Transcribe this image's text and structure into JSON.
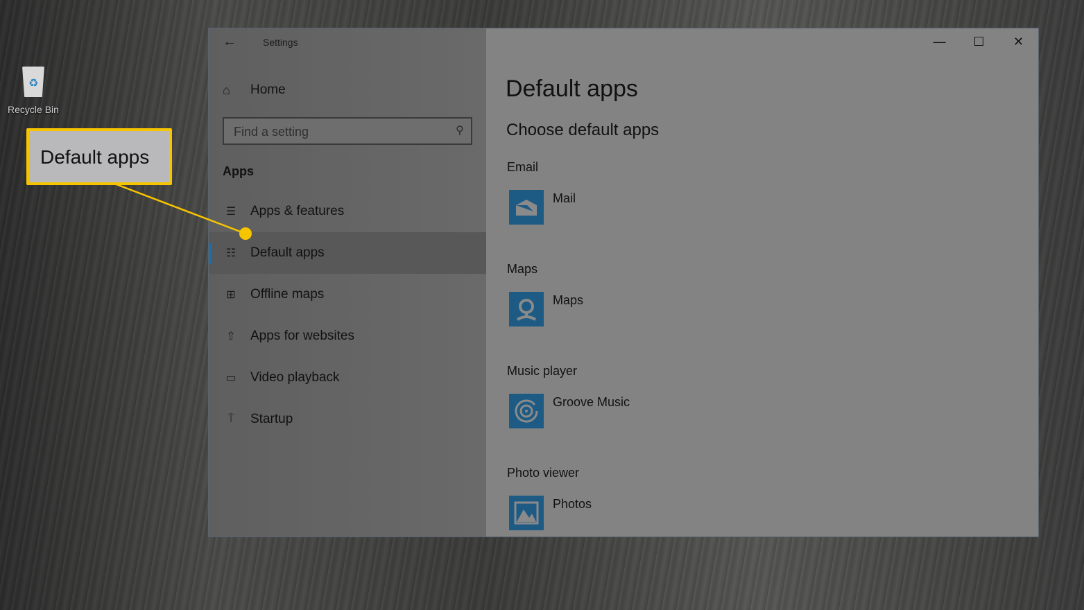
{
  "desktop": {
    "recycle_bin_label": "Recycle Bin"
  },
  "callout": {
    "label": "Default apps",
    "color": "#f6c500"
  },
  "window": {
    "title": "Settings",
    "controls": {
      "minimize": "—",
      "maximize": "☐",
      "close": "✕"
    },
    "back_icon": "←"
  },
  "sidebar": {
    "home_label": "Home",
    "home_icon": "⌂",
    "search": {
      "placeholder": "Find a setting",
      "value": "",
      "icon": "⚲"
    },
    "section_title": "Apps",
    "items": [
      {
        "label": "Apps & features",
        "icon": "☰",
        "active": false
      },
      {
        "label": "Default apps",
        "icon": "☷",
        "active": true
      },
      {
        "label": "Offline maps",
        "icon": "⊞",
        "active": false
      },
      {
        "label": "Apps for websites",
        "icon": "⇧",
        "active": false
      },
      {
        "label": "Video playback",
        "icon": "▭",
        "active": false
      },
      {
        "label": "Startup",
        "icon": "⍑",
        "active": false
      }
    ],
    "accent_color": "#1f6ea7"
  },
  "main": {
    "title": "Default apps",
    "subtitle": "Choose default apps",
    "categories": [
      {
        "label": "Email",
        "app": "Mail"
      },
      {
        "label": "Maps",
        "app": "Maps"
      },
      {
        "label": "Music player",
        "app": "Groove Music"
      },
      {
        "label": "Photo viewer",
        "app": "Photos"
      }
    ],
    "tile_color": "#1d5b85"
  }
}
